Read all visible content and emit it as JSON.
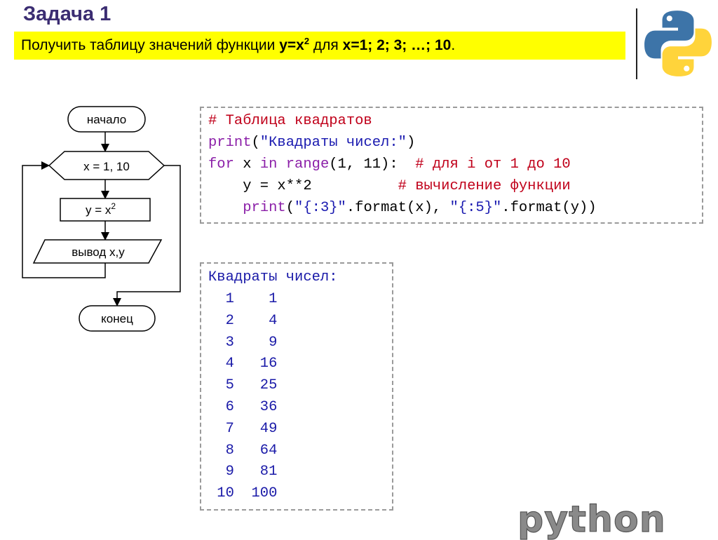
{
  "header": {
    "title": "Задача 1",
    "task": {
      "prefix": "Получить таблицу значений функции ",
      "func_base": "y=x",
      "func_exp": "2",
      "middle": " для ",
      "range": "x=1; 2; 3; …; 10",
      "suffix": "."
    }
  },
  "flowchart": {
    "start": "начало",
    "loop": "x = 1, 10",
    "assign_base": "y = x",
    "assign_exp": "2",
    "output": "вывод x,y",
    "end": "конец"
  },
  "code": {
    "line1_comment": "# Таблица квадратов",
    "line2_func": "print",
    "line2_open": "(",
    "line2_str": "\"Квадраты чисел:\"",
    "line2_close": ")",
    "line3_for": "for",
    "line3_x": " x ",
    "line3_in": "in",
    "line3_sp": " ",
    "line3_range": "range",
    "line3_args": "(1, 11):  ",
    "line3_comment": "# для i от 1 до 10",
    "line4_code": "    y = x**2          ",
    "line4_comment": "# вычисление функции",
    "line5_indent": "    ",
    "line5_func": "print",
    "line5_open": "(",
    "line5_str1": "\"{:3}\"",
    "line5_mid": ".format(x), ",
    "line5_str2": "\"{:5}\"",
    "line5_end": ".format(y))"
  },
  "output": {
    "header": "Квадраты чисел:",
    "rows": [
      {
        "x": "1",
        "y": "1"
      },
      {
        "x": "2",
        "y": "4"
      },
      {
        "x": "3",
        "y": "9"
      },
      {
        "x": "4",
        "y": "16"
      },
      {
        "x": "5",
        "y": "25"
      },
      {
        "x": "6",
        "y": "36"
      },
      {
        "x": "7",
        "y": "49"
      },
      {
        "x": "8",
        "y": "64"
      },
      {
        "x": "9",
        "y": "81"
      },
      {
        "x": "10",
        "y": "100"
      }
    ]
  },
  "branding": {
    "logo": "python-logo-icon",
    "wordmark": "python",
    "colors": {
      "blue": "#3d74a8",
      "yellow": "#ffd43b",
      "word": "#8a8a8a",
      "highlight": "#ffff00"
    }
  }
}
